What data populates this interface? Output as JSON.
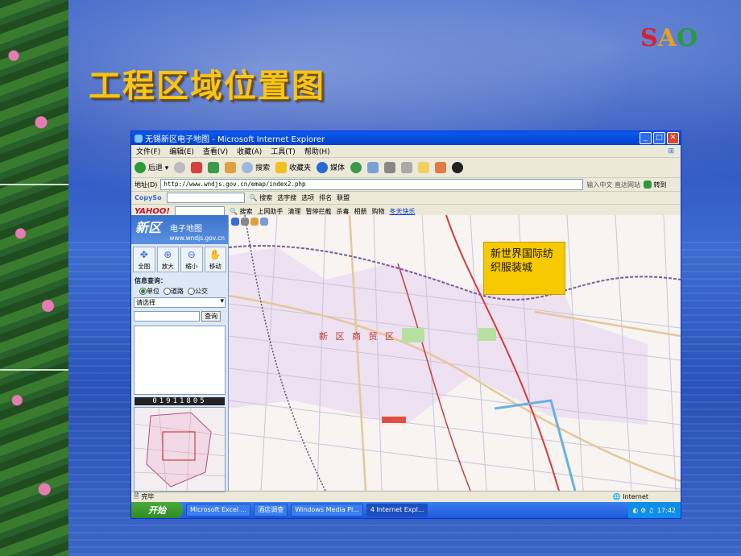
{
  "slide": {
    "title": "工程区域位置图",
    "logo": [
      "S",
      "A",
      "O"
    ]
  },
  "window": {
    "title": "无锡新区电子地图 - Microsoft Internet Explorer",
    "menu": [
      "文件(F)",
      "编辑(E)",
      "查看(V)",
      "收藏(A)",
      "工具(T)",
      "帮助(H)"
    ],
    "toolbar": {
      "back": "后退",
      "search": "搜索",
      "favorites": "收藏夹",
      "media": "媒体"
    },
    "address": {
      "label": "地址(D)",
      "url": "http://www.wndjs.gov.cn/emap/index2.php",
      "input_hint": "输入中文 直达网站",
      "go": "转到"
    },
    "copyso": {
      "brand": "CopySo",
      "search": "搜索",
      "select": "选字搜",
      "options": "选项",
      "rank": "排名",
      "union": "联盟"
    },
    "yahoo": {
      "brand": "YAHOO!",
      "search": "搜索",
      "assistant": "上网助手",
      "clean": "清理",
      "block": "暂停拦截",
      "antivirus": "杀毒",
      "album": "相册",
      "shop": "购物",
      "link": "冬天快乐"
    }
  },
  "sidebar": {
    "logo_big": "新区",
    "logo_sub": "电子地图",
    "site": "www.wndjs.gov.cn",
    "tools": [
      "全图",
      "放大",
      "缩小",
      "移动"
    ],
    "info_label": "信息查询：",
    "radios": [
      "单位",
      "道路",
      "公交"
    ],
    "select_placeholder": "请选择",
    "query_button": "查询",
    "counter": "01911805"
  },
  "map": {
    "district_label": "新 区 商 贸 区",
    "callout": "新世界国际纺织服装城"
  },
  "statusbar": {
    "left": "完毕",
    "right": "Internet"
  },
  "taskbar": {
    "start": "开始",
    "tasks": [
      "Microsoft Excel ...",
      "酒店调查",
      "Windows Media Pl...",
      "4 Internet Expl..."
    ],
    "time": "17:42"
  }
}
